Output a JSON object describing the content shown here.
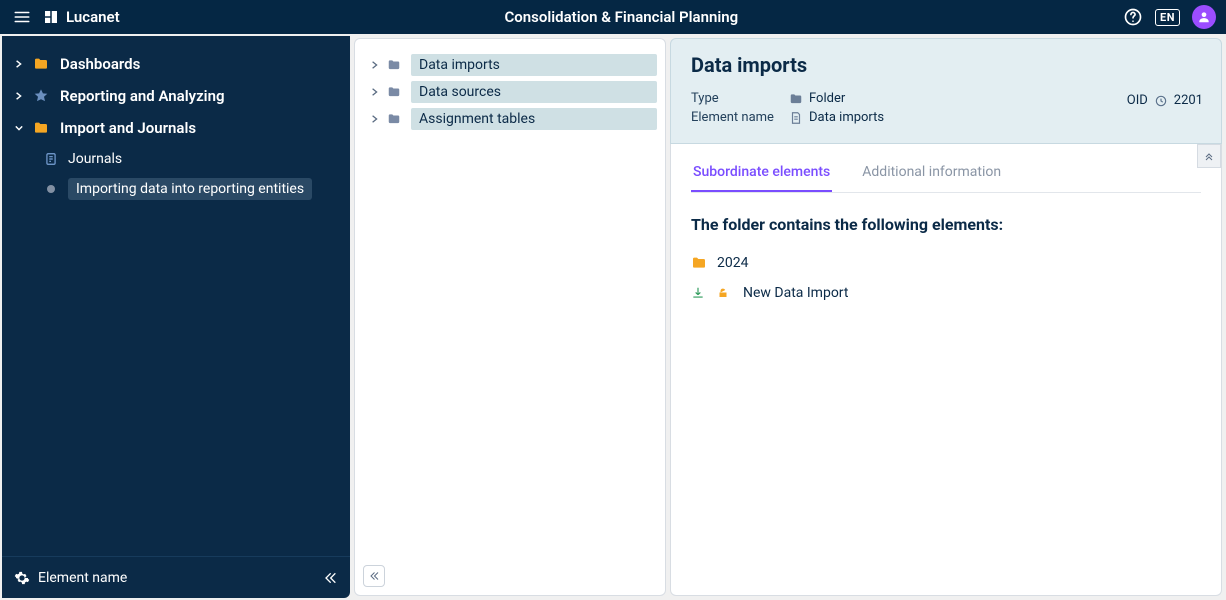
{
  "topbar": {
    "brand": "Lucanet",
    "title": "Consolidation & Financial Planning",
    "language": "EN"
  },
  "sidebar": {
    "items": [
      {
        "label": "Dashboards"
      },
      {
        "label": "Reporting and Analyzing"
      },
      {
        "label": "Import and Journals"
      }
    ],
    "subitems": [
      {
        "label": "Journals"
      },
      {
        "label": "Importing data into reporting entities"
      }
    ],
    "footer_label": "Element name"
  },
  "midtree": {
    "items": [
      {
        "label": "Data imports"
      },
      {
        "label": "Data sources"
      },
      {
        "label": "Assignment tables"
      }
    ]
  },
  "detail": {
    "title": "Data imports",
    "type_label": "Type",
    "type_value": "Folder",
    "name_label": "Element name",
    "name_value": "Data imports",
    "oid_label": "OID",
    "oid_value": "2201",
    "tabs": [
      {
        "label": "Subordinate elements"
      },
      {
        "label": "Additional information"
      }
    ],
    "sentence": "The folder contains the following elements:",
    "elements": [
      {
        "label": "2024"
      },
      {
        "label": "New Data Import"
      }
    ]
  }
}
